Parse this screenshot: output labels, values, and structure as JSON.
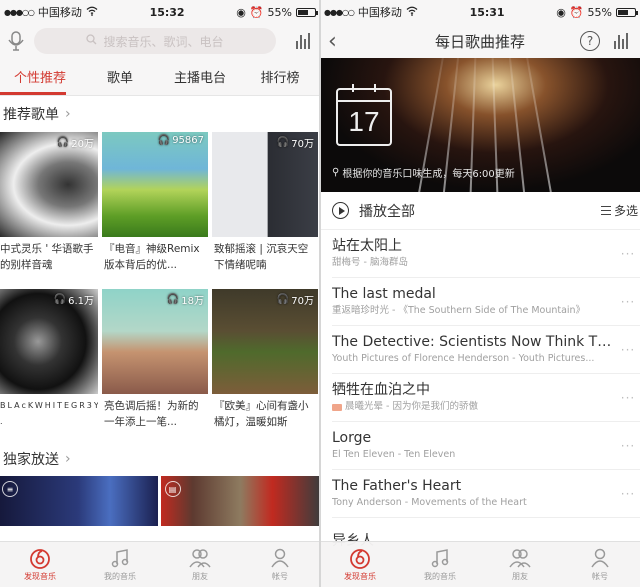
{
  "left": {
    "status": {
      "carrier": "中国移动",
      "time": "15:32",
      "battery": "55%",
      "battery_level": 0.55
    },
    "search": {
      "placeholder": "搜索音乐、歌词、电台"
    },
    "tabs": [
      {
        "label": "个性推荐",
        "active": true
      },
      {
        "label": "歌单",
        "active": false
      },
      {
        "label": "主播电台",
        "active": false
      },
      {
        "label": "排行榜",
        "active": false
      }
    ],
    "section_playlists": {
      "title": "推荐歌单",
      "chevron": "›"
    },
    "playlists": [
      {
        "count": "20万",
        "title": "中式灵乐 ' 华语歌手的别样音魂"
      },
      {
        "count": "95867",
        "title": "『电音』神级Remix版本背后的优..."
      },
      {
        "count": "70万",
        "title": "致郁摇滚 | 沉哀天空下情绪呢喃"
      },
      {
        "count": "6.1万",
        "title": "BLAcKWHITEGR3Y ."
      },
      {
        "count": "18万",
        "title": "亮色调后摇！为新的一年添上一笔..."
      },
      {
        "count": "70万",
        "title": "『欧美』心间有盏小橘灯，温暖如斯"
      }
    ],
    "section_exclusive": {
      "title": "独家放送",
      "chevron": "›"
    },
    "bottom_nav": [
      {
        "label": "发现音乐",
        "icon": "netease-music-icon",
        "active": true
      },
      {
        "label": "我的音乐",
        "icon": "music-note-icon",
        "active": false
      },
      {
        "label": "朋友",
        "icon": "friends-icon",
        "active": false
      },
      {
        "label": "帐号",
        "icon": "account-icon",
        "active": false
      }
    ]
  },
  "right": {
    "status": {
      "carrier": "中国移动",
      "time": "15:31",
      "battery": "55%",
      "battery_level": 0.55
    },
    "header": {
      "title": "每日歌曲推荐",
      "help": "?"
    },
    "hero": {
      "day": "17",
      "note": "根据你的音乐口味生成，每天6:00更新"
    },
    "play_all": "播放全部",
    "multi_select": "多选",
    "songs": [
      {
        "title": "站在太阳上",
        "sub": "甜梅号 - 脑海群岛",
        "sq": false
      },
      {
        "title": "The last medal",
        "sub": "重返暗珍时光 - 《The Southern Side of The Mountain》",
        "sq": false
      },
      {
        "title": "The Detective: Scientists Now Think Th...",
        "sub": "Youth Pictures of Florence Henderson - Youth Pictures...",
        "sq": false
      },
      {
        "title": "牺牲在血泊之中",
        "sub": "晨曦光晕 - 因为你是我们的骄傲",
        "sq": true
      },
      {
        "title": "Lorge",
        "sub": "El Ten Eleven - Ten Eleven",
        "sq": false
      },
      {
        "title": "The Father's Heart",
        "sub": "Tony Anderson - Movements of the Heart",
        "sq": false
      },
      {
        "title": "异乡人",
        "sub": "",
        "sq": false
      }
    ],
    "bottom_nav": [
      {
        "label": "发现音乐",
        "icon": "netease-music-icon",
        "active": true
      },
      {
        "label": "我的音乐",
        "icon": "music-note-icon",
        "active": false
      },
      {
        "label": "朋友",
        "icon": "friends-icon",
        "active": false
      },
      {
        "label": "帐号",
        "icon": "account-icon",
        "active": false
      }
    ]
  },
  "colors": {
    "accent": "#d33a31",
    "text": "#333333",
    "muted": "#a0a0a0",
    "bar_bg": "#f7f6f6"
  }
}
